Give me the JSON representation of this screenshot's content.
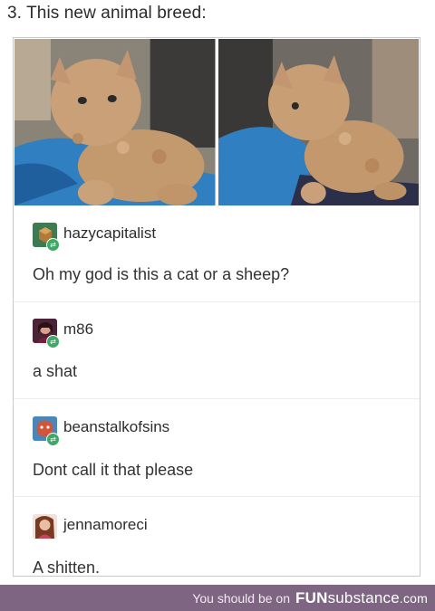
{
  "heading": "3. This new animal breed:",
  "photos": [
    {
      "alt_icon": "curly-kitten-photo"
    },
    {
      "alt_icon": "curly-kitten-photo"
    }
  ],
  "posts": [
    {
      "username": "hazycapitalist",
      "text": "Oh my god is this a cat or a sheep?"
    },
    {
      "username": "m86",
      "text": "a shat"
    },
    {
      "username": "beanstalkofsins",
      "text": "Dont call it that please"
    },
    {
      "username": "jennamoreci",
      "text": "A shitten."
    }
  ],
  "footer": {
    "text": "You should be on",
    "brand_bold": "FUN",
    "brand_light": "substance",
    "brand_domain": ".com",
    "color": "#7e6582"
  }
}
